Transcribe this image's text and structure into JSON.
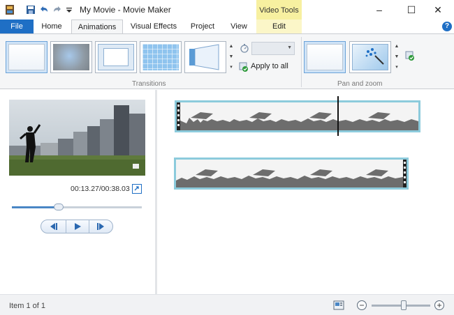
{
  "window": {
    "title": "My Movie - Movie Maker",
    "context_tab_group": "Video Tools",
    "minimize_glyph": "–",
    "maximize_glyph": "☐",
    "close_glyph": "✕"
  },
  "quick_access": {
    "icons": [
      "app-icon",
      "save-icon",
      "undo-icon",
      "redo-icon",
      "customize-dropdown-icon"
    ]
  },
  "tabs": {
    "file": "File",
    "items": [
      "Home",
      "Animations",
      "Visual Effects",
      "Project",
      "View"
    ],
    "active": "Animations",
    "edit": "Edit",
    "help_glyph": "?"
  },
  "ribbon": {
    "transitions_label": "Transitions",
    "apply_to_all": "Apply to all",
    "duration_value": "",
    "pan_zoom_label": "Pan and zoom"
  },
  "preview": {
    "time": "00:13.27/00:38.03",
    "seek_fraction": 0.36
  },
  "status": {
    "item_text": "Item 1 of 1",
    "zoom_fraction": 0.55
  },
  "colors": {
    "accent": "#1f6fc5",
    "context_tab": "#f7f0a0",
    "clip_border": "#8ccbdc"
  }
}
